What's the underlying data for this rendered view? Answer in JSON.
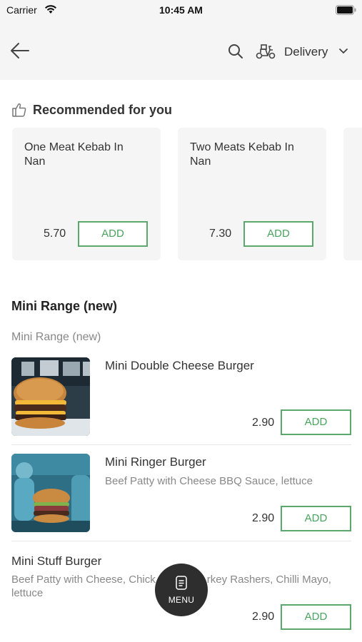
{
  "status_bar": {
    "carrier": "Carrier",
    "time": "10:45 AM"
  },
  "header": {
    "delivery_label": "Delivery"
  },
  "recommended": {
    "title": "Recommended for you",
    "items": [
      {
        "name": "One Meat Kebab In Nan",
        "price": "5.70",
        "add_label": "ADD"
      },
      {
        "name": "Two Meats Kebab In Nan",
        "price": "7.30",
        "add_label": "ADD"
      }
    ]
  },
  "section": {
    "title": "Mini Range (new)",
    "subtitle": "Mini Range (new)",
    "items": [
      {
        "name": "Mini Double Cheese Burger",
        "description": "",
        "price": "2.90",
        "add_label": "ADD"
      },
      {
        "name": "Mini Ringer Burger",
        "description": "Beef Patty with Cheese BBQ Sauce, lettuce",
        "price": "2.90",
        "add_label": "ADD"
      },
      {
        "name": "Mini Stuff Burger",
        "description": "Beef Patty with Cheese, Chick",
        "description_tail": "rkey Rashers, Chilli Mayo,",
        "description_line2": "lettuce",
        "price": "2.90",
        "add_label": "ADD"
      }
    ]
  },
  "fab": {
    "label": "MENU"
  },
  "colors": {
    "accent": "#5aa86c",
    "header_bg": "#f5f5f5",
    "fab_bg": "#2e2e2e"
  }
}
